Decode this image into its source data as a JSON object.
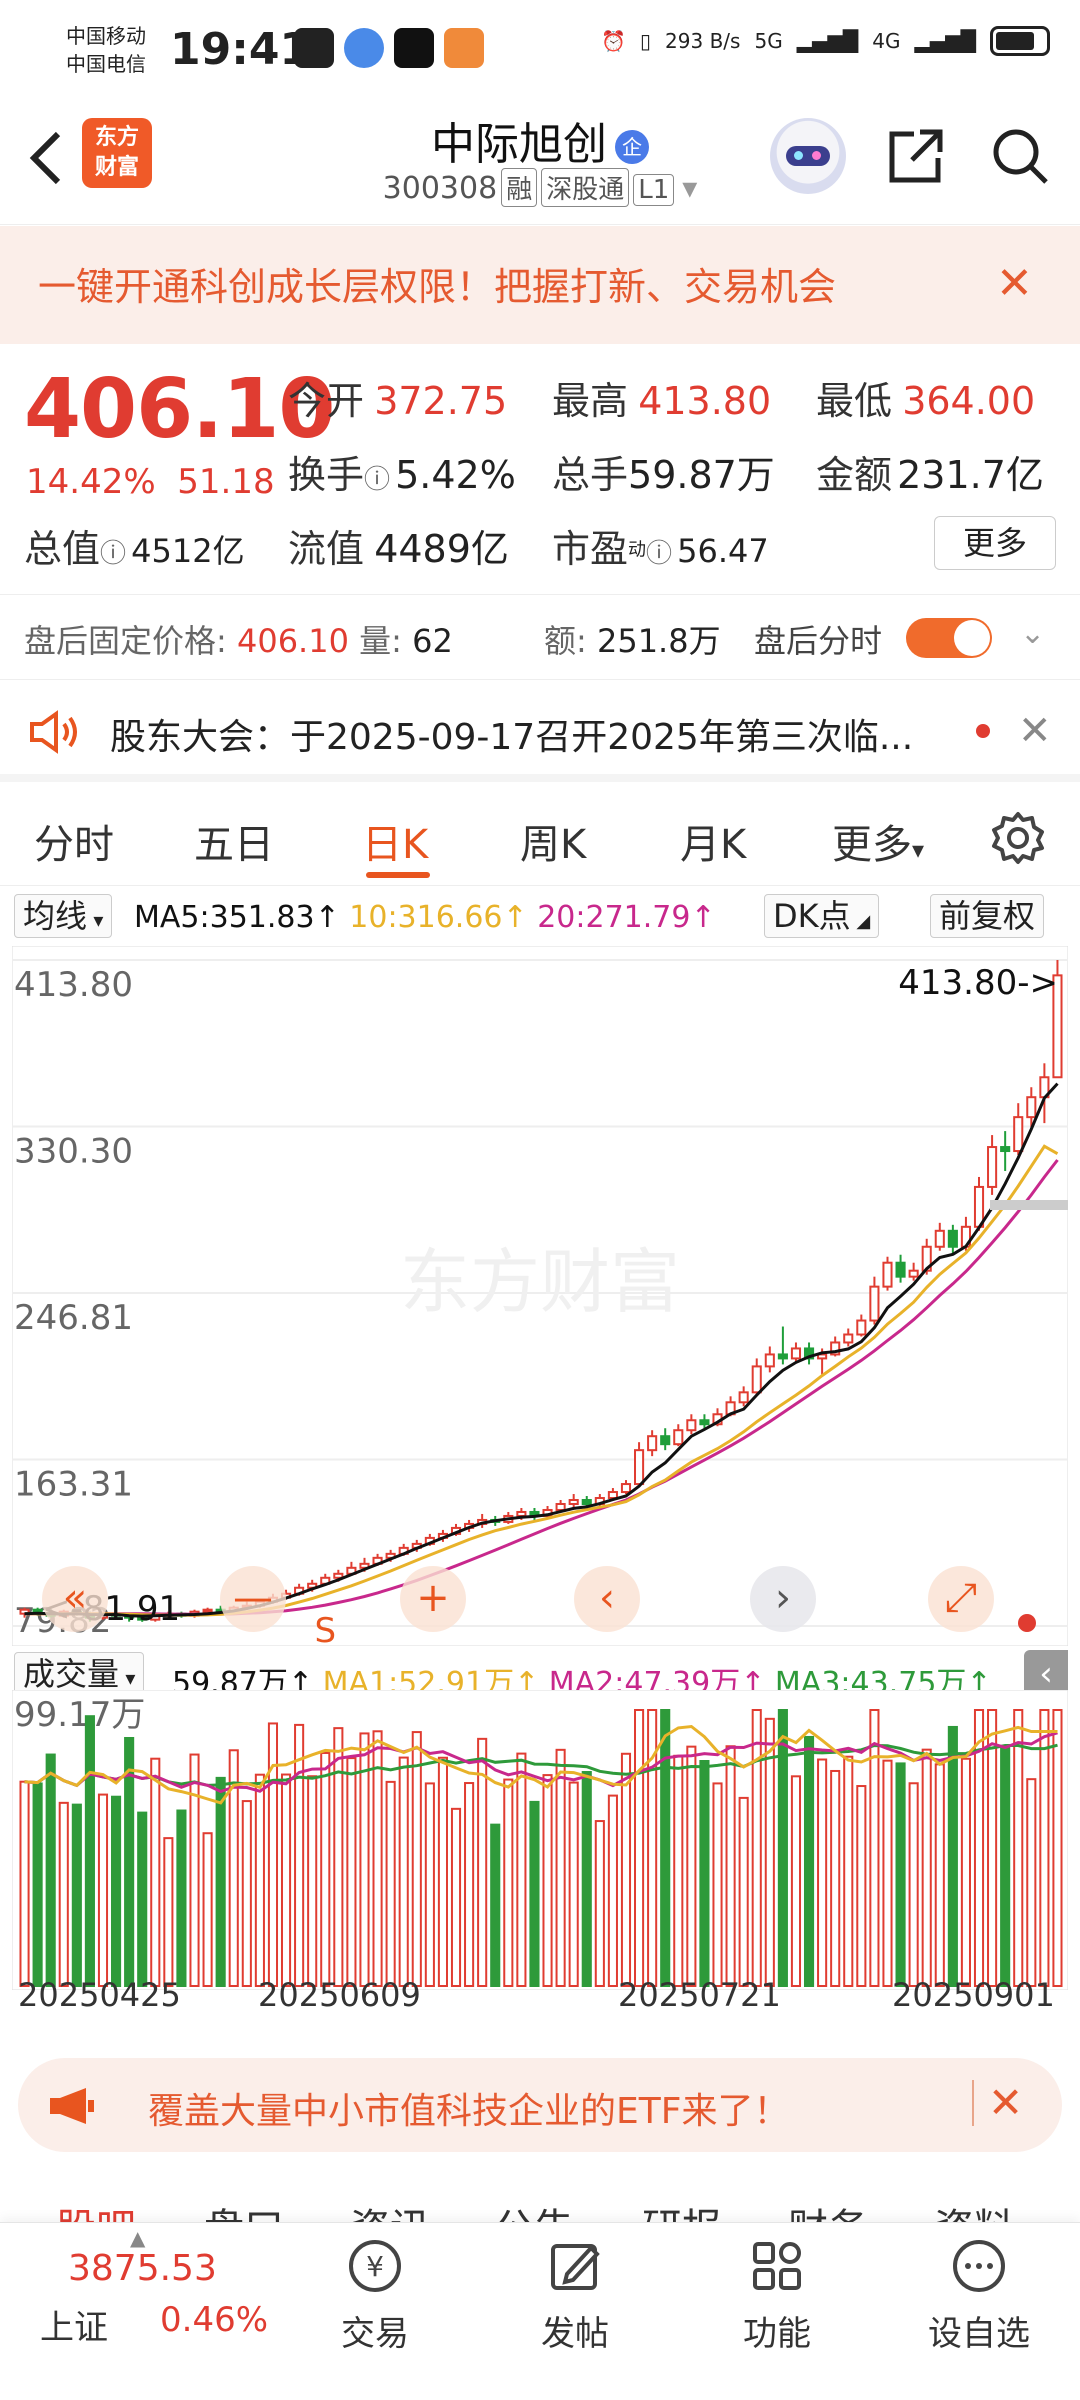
{
  "status_bar": {
    "carrier_1": "中国移动",
    "carrier_2": "中国电信",
    "time": "19:41",
    "net_speed": "293 B/s",
    "network_1": "5G",
    "network_2": "4G"
  },
  "header": {
    "stock_name": "中际旭创",
    "name_badge": "企",
    "stock_code": "300308",
    "tag_margin": "融",
    "tag_connect": "深股通",
    "tag_level": "L1",
    "logo_line1": "东方",
    "logo_line2": "财富"
  },
  "promo": {
    "text": "一键开通科创成长层权限！把握打新、交易机会",
    "close": "✕"
  },
  "quote": {
    "price": "406.10",
    "change_pct": "14.42%",
    "change_amt": "51.18",
    "open_label": "今开",
    "open": "372.75",
    "high_label": "最高",
    "high": "413.80",
    "low_label": "最低",
    "low": "364.00",
    "turnover_label": "换手",
    "turnover": "5.42%",
    "volume_label": "总手",
    "volume": "59.87万",
    "amount_label": "金额",
    "amount": "231.7亿",
    "mktcap_label": "总值",
    "mktcap": "4512亿",
    "float_label": "流值",
    "float_cap": "4489亿",
    "pe_label": "市盈",
    "pe_sup": "动",
    "pe": "56.47",
    "more": "更多"
  },
  "after_hours": {
    "price_label": "盘后固定价格:",
    "price": "406.10",
    "vol_label": "量:",
    "vol": "62",
    "amt_label": "额:",
    "amt": "251.8万",
    "timeshare_label": "盘后分时"
  },
  "notice": {
    "text": "股东大会：于2025-09-17召开2025年第三次临...",
    "close": "✕"
  },
  "tabs": [
    "分时",
    "五日",
    "日K",
    "周K",
    "月K",
    "更多"
  ],
  "ma_legend": {
    "button": "均线",
    "ma5": "MA5:351.83↑",
    "ma10": "10:316.66↑",
    "ma20": "20:271.79↑",
    "dk_button": "DK点",
    "adjust_button": "前复权",
    "colors": {
      "ma5": "#111111",
      "ma10": "#e8b22a",
      "ma20": "#c8288c"
    }
  },
  "chart_data": {
    "type": "candlestick",
    "y_ticks": [
      "413.80",
      "330.30",
      "246.81",
      "163.31",
      "79.82"
    ],
    "high_marker": "413.80->",
    "low_marker": "<-81.91",
    "ylim": [
      79.82,
      413.8
    ],
    "x_ticks": [
      "20250425",
      "20250609",
      "20250721",
      "20250901"
    ],
    "watermark": "东方财富",
    "candles": [
      [
        86,
        88,
        84,
        89
      ],
      [
        88,
        86,
        85,
        89
      ],
      [
        86,
        85,
        84,
        88
      ],
      [
        85,
        87,
        84,
        88
      ],
      [
        87,
        86,
        85,
        88
      ],
      [
        86,
        84,
        82,
        87
      ],
      [
        84,
        86,
        83,
        87
      ],
      [
        86,
        85,
        84,
        87
      ],
      [
        85,
        84,
        82,
        86
      ],
      [
        84,
        83,
        81.91,
        85
      ],
      [
        83,
        85,
        82,
        86
      ],
      [
        85,
        86,
        84,
        87
      ],
      [
        86,
        85,
        84,
        87
      ],
      [
        85,
        87,
        84,
        88
      ],
      [
        87,
        88,
        86,
        89
      ],
      [
        88,
        87,
        86,
        90
      ],
      [
        87,
        89,
        86,
        90
      ],
      [
        89,
        90,
        88,
        92
      ],
      [
        90,
        92,
        89,
        93
      ],
      [
        92,
        94,
        91,
        96
      ],
      [
        94,
        96,
        93,
        98
      ],
      [
        96,
        99,
        95,
        101
      ],
      [
        99,
        101,
        97,
        103
      ],
      [
        101,
        104,
        100,
        106
      ],
      [
        104,
        106,
        102,
        108
      ],
      [
        106,
        109,
        105,
        112
      ],
      [
        109,
        111,
        107,
        114
      ],
      [
        111,
        114,
        110,
        116
      ],
      [
        114,
        116,
        112,
        118
      ],
      [
        116,
        119,
        115,
        121
      ],
      [
        119,
        121,
        117,
        123
      ],
      [
        121,
        124,
        120,
        126
      ],
      [
        124,
        126,
        122,
        128
      ],
      [
        126,
        129,
        125,
        131
      ],
      [
        129,
        131,
        127,
        133
      ],
      [
        131,
        133,
        129,
        136
      ],
      [
        133,
        132,
        130,
        135
      ],
      [
        132,
        135,
        131,
        137
      ],
      [
        135,
        137,
        133,
        139
      ],
      [
        137,
        135,
        133,
        139
      ],
      [
        135,
        138,
        134,
        140
      ],
      [
        138,
        141,
        137,
        143
      ],
      [
        141,
        143,
        139,
        146
      ],
      [
        143,
        141,
        139,
        145
      ],
      [
        141,
        144,
        140,
        146
      ],
      [
        144,
        147,
        143,
        149
      ],
      [
        147,
        151,
        146,
        153
      ],
      [
        151,
        168,
        150,
        172
      ],
      [
        168,
        175,
        165,
        178
      ],
      [
        175,
        171,
        168,
        179
      ],
      [
        171,
        178,
        170,
        181
      ],
      [
        178,
        183,
        176,
        186
      ],
      [
        183,
        181,
        179,
        186
      ],
      [
        181,
        186,
        180,
        189
      ],
      [
        186,
        192,
        185,
        195
      ],
      [
        192,
        197,
        190,
        200
      ],
      [
        197,
        210,
        196,
        214
      ],
      [
        210,
        216,
        207,
        220
      ],
      [
        216,
        214,
        211,
        230
      ],
      [
        214,
        219,
        212,
        222
      ],
      [
        219,
        214,
        211,
        222
      ],
      [
        214,
        216,
        206,
        219
      ],
      [
        216,
        222,
        215,
        225
      ],
      [
        222,
        226,
        220,
        229
      ],
      [
        226,
        233,
        225,
        236
      ],
      [
        233,
        250,
        231,
        255
      ],
      [
        250,
        262,
        248,
        265
      ],
      [
        262,
        255,
        252,
        266
      ],
      [
        255,
        258,
        253,
        262
      ],
      [
        258,
        270,
        256,
        274
      ],
      [
        270,
        278,
        268,
        282
      ],
      [
        278,
        270,
        266,
        281
      ],
      [
        270,
        280,
        268,
        285
      ],
      [
        280,
        300,
        278,
        305
      ],
      [
        300,
        320,
        296,
        326
      ],
      [
        320,
        318,
        308,
        328
      ],
      [
        318,
        335,
        316,
        342
      ],
      [
        335,
        345,
        330,
        350
      ],
      [
        345,
        355,
        332,
        362
      ],
      [
        355,
        406.1,
        364,
        413.8
      ]
    ],
    "ma5": [
      86,
      86.2,
      86,
      85.8,
      86,
      85.6,
      85.5,
      85.6,
      85,
      84.8,
      85,
      85.2,
      85.4,
      85.6,
      86,
      86.6,
      87.4,
      88.6,
      90,
      91.8,
      93.8,
      96,
      98.4,
      100.6,
      103,
      105.6,
      108.2,
      110.8,
      113.4,
      116,
      118.8,
      121.4,
      124,
      126.6,
      129.2,
      131.4,
      132.6,
      133.6,
      134.4,
      134.8,
      135.6,
      137.2,
      138.8,
      139.6,
      141.2,
      143.2,
      145,
      150,
      157,
      161.6,
      168.4,
      175,
      178.4,
      182,
      186.2,
      188.6,
      195.6,
      202.4,
      208,
      212,
      214.8,
      216.8,
      217.4,
      218.8,
      222.4,
      229.4,
      239.4,
      245.2,
      251.2,
      259,
      264.6,
      266.2,
      270.2,
      279.6,
      289.6,
      301.6,
      314.6,
      329,
      344.6,
      351.83
    ],
    "ma10": [
      86,
      86,
      86,
      86,
      86,
      86,
      86,
      85.8,
      85.7,
      85.5,
      85.3,
      85.3,
      85.3,
      85.3,
      85.4,
      85.7,
      86.2,
      86.9,
      87.8,
      88.8,
      90.1,
      91.8,
      93.6,
      95.7,
      97.8,
      100,
      102.4,
      104.9,
      107.4,
      110.1,
      112.8,
      115.4,
      118,
      120.6,
      123.2,
      125.5,
      127.6,
      129.2,
      130.9,
      132.3,
      133.8,
      135.4,
      136.9,
      138.2,
      139.4,
      140.6,
      142.2,
      145.6,
      149.8,
      153,
      157.6,
      162,
      165.4,
      168.8,
      172.8,
      177.2,
      182.2,
      186.8,
      191.2,
      195.6,
      200.2,
      205.4,
      210,
      214.8,
      219.2,
      224.6,
      231.2,
      236.6,
      242.2,
      249.6,
      256.2,
      261.6,
      266.9,
      274.4,
      282.6,
      291,
      300.4,
      310.4,
      320.4,
      316.66
    ],
    "ma20": [
      86,
      86,
      86,
      86,
      86,
      86,
      86,
      86,
      86,
      86,
      85.9,
      85.8,
      85.8,
      85.7,
      85.7,
      85.8,
      85.9,
      86.2,
      86.5,
      87,
      87.5,
      88.3,
      89.2,
      90.3,
      91.6,
      93,
      94.6,
      96.4,
      98.4,
      100.5,
      102.7,
      105.1,
      107.5,
      110,
      112.6,
      115.2,
      117.9,
      120.6,
      123.3,
      126,
      128.7,
      131.3,
      133.8,
      136.2,
      138.5,
      140.8,
      143,
      146,
      149.4,
      152.5,
      156,
      159.6,
      163,
      166.5,
      170.2,
      174,
      178.1,
      182.3,
      186.8,
      191.2,
      195.6,
      200,
      204.3,
      208.6,
      213,
      217.8,
      223,
      228,
      233.4,
      239.4,
      245.6,
      251.4,
      257.6,
      264.6,
      272,
      279.6,
      287.6,
      296,
      305,
      313.5
    ],
    "dk_markers": [
      {
        "index": 23,
        "label": "S"
      }
    ]
  },
  "volume": {
    "button": "成交量",
    "vol": "59.87万↑",
    "ma1": "MA1:52.91万↑",
    "ma2": "MA2:47.39万↑",
    "ma3": "MA3:43.75万↑",
    "max_label": "99.17万",
    "colors": {
      "ma1": "#e8b22a",
      "ma2": "#c8288c",
      "ma3": "#2e9a3a"
    }
  },
  "etf_banner": {
    "text": "覆盖大量中小市值科技企业的ETF来了！",
    "close": "✕"
  },
  "sub_tabs": [
    "股吧",
    "盘口",
    "资讯",
    "公告",
    "研报",
    "财务",
    "资料"
  ],
  "bottom_nav": {
    "index_value": "3875.53",
    "index_name": "上证",
    "index_change": "0.46%",
    "items": [
      "交易",
      "发帖",
      "功能",
      "设自选"
    ]
  }
}
